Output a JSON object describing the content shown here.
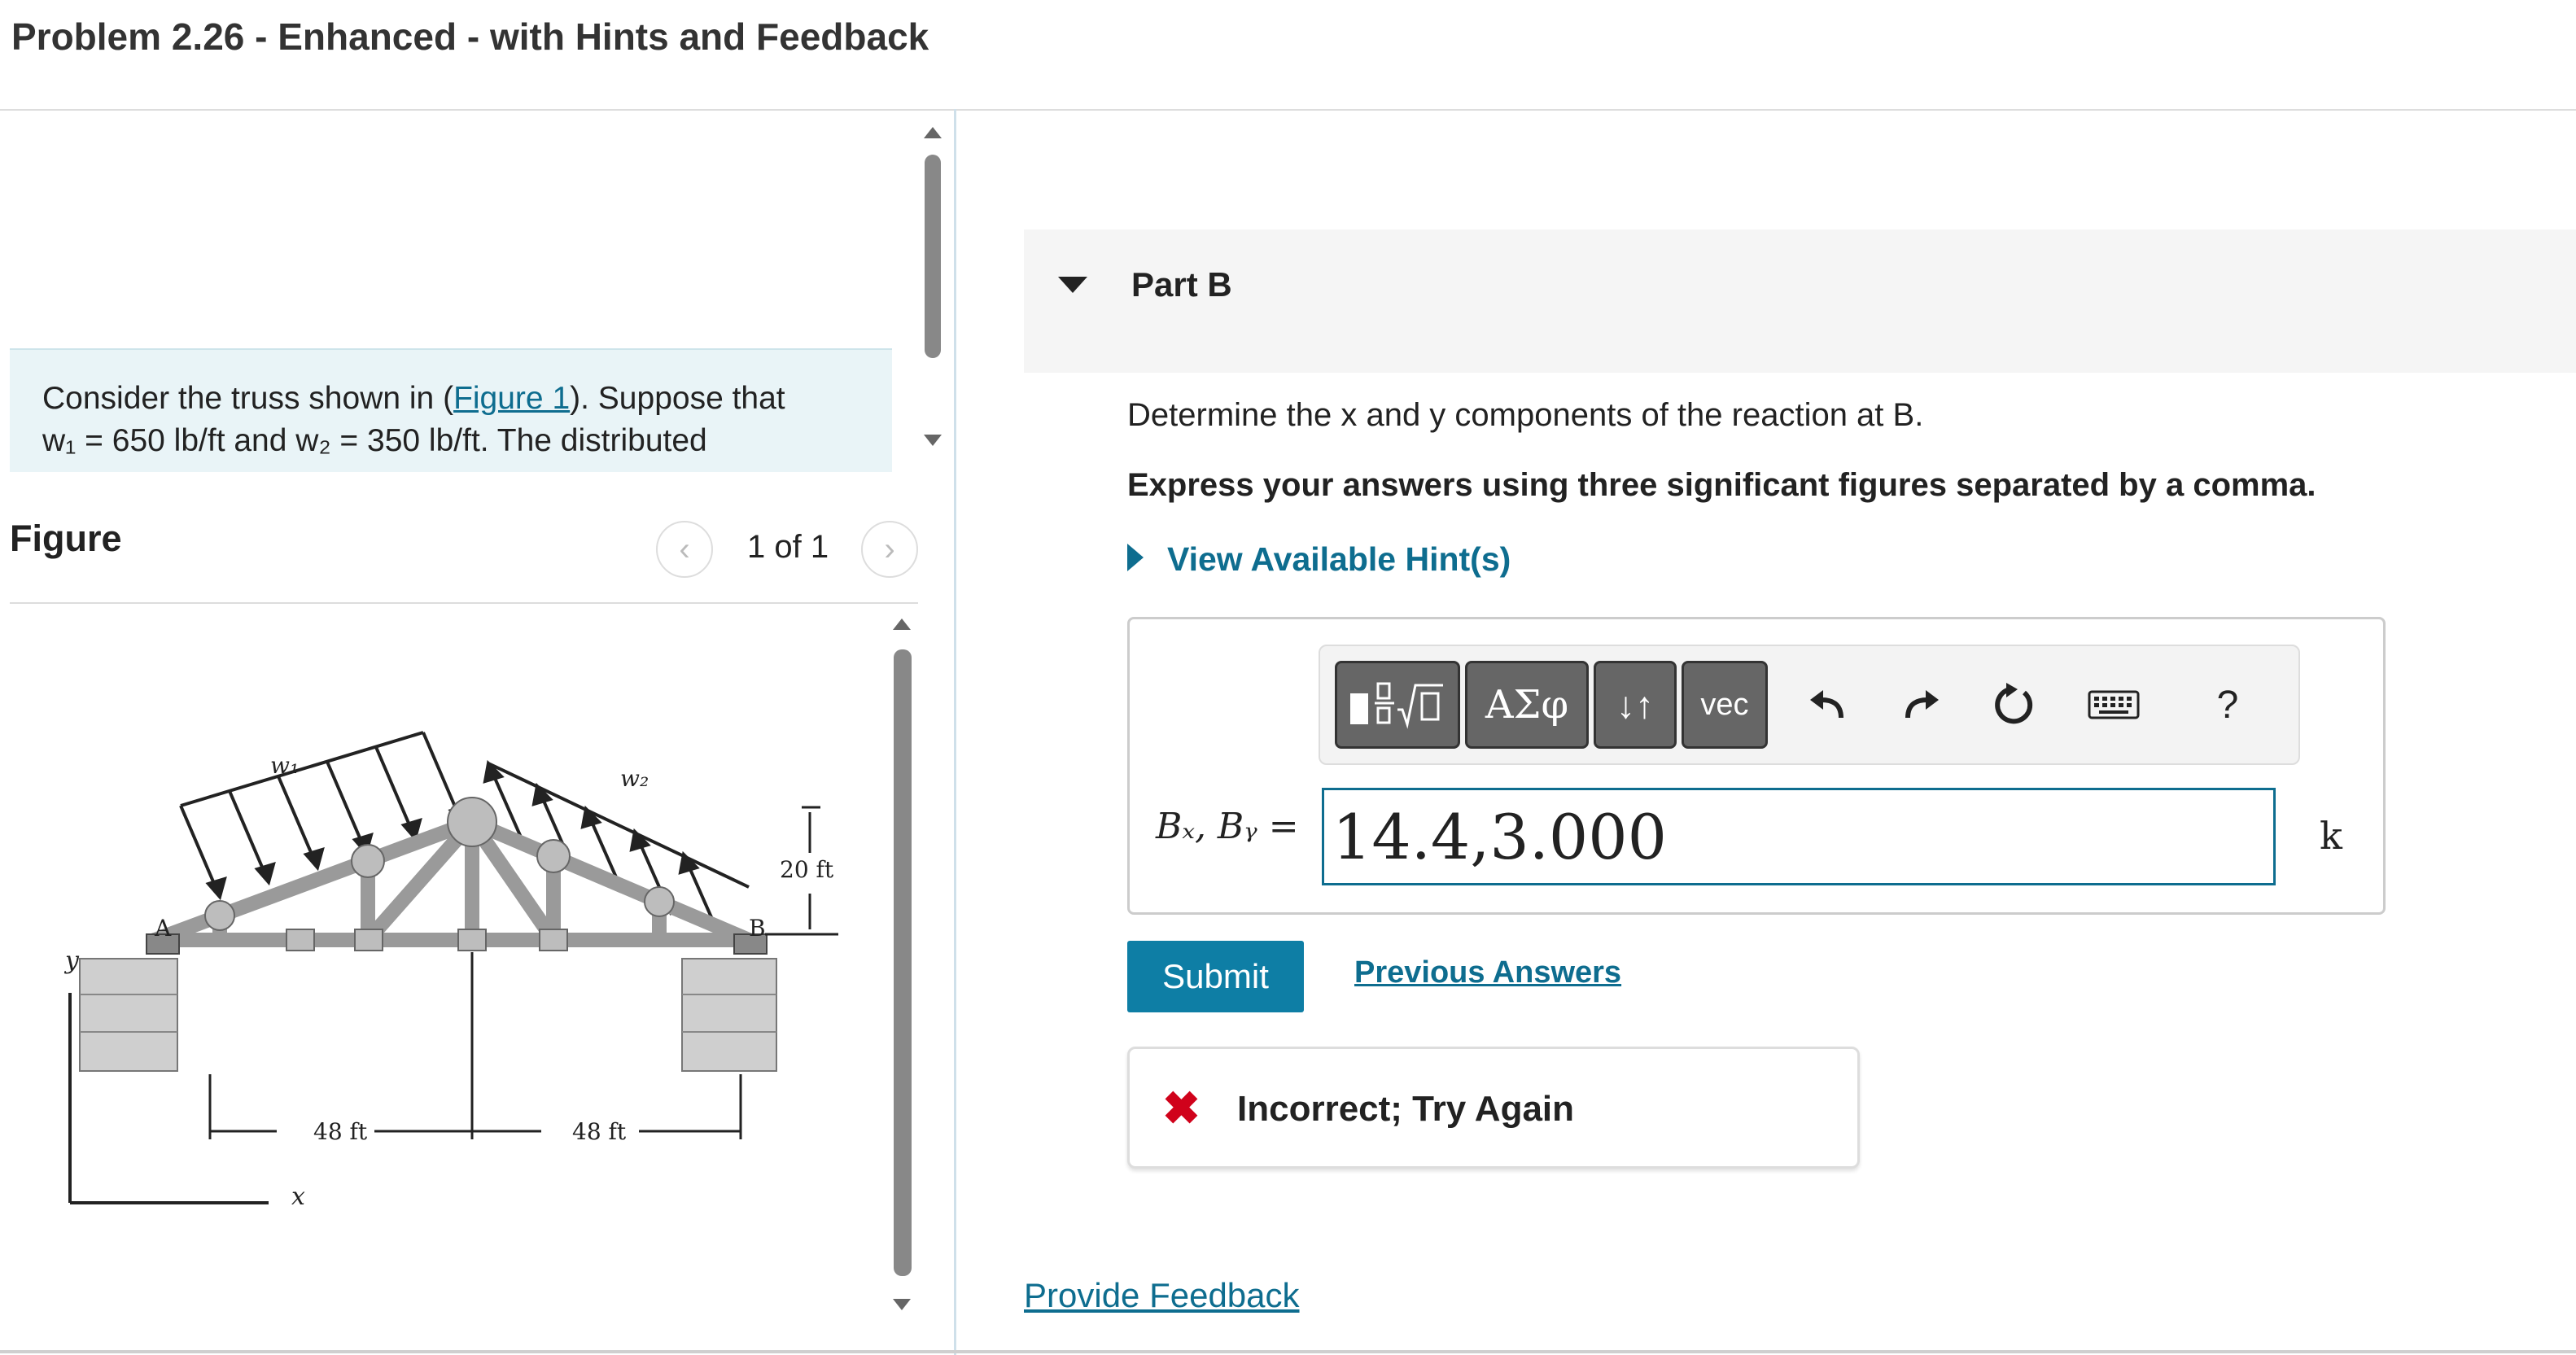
{
  "header": {
    "title": "Problem 2.26 - Enhanced - with Hints and Feedback"
  },
  "problem": {
    "line1_before": "Consider the truss shown in (",
    "figure_link": "Figure 1",
    "line1_after": "). Suppose that",
    "line2": "w₁ = 650 lb/ft and w₂ = 350 lb/ft. The distributed"
  },
  "figure_panel": {
    "label": "Figure",
    "count": "1 of 1",
    "prev_icon": "chevron-left-icon",
    "next_icon": "chevron-right-icon",
    "labels": {
      "w1": "w₁",
      "w2": "w₂",
      "height": "20 ft",
      "span1": "48 ft",
      "span2": "48 ft",
      "A": "A",
      "B": "B",
      "x": "x",
      "y": "y"
    }
  },
  "part": {
    "title": "Part B",
    "question": "Determine the x and y components of the reaction at B.",
    "instruction": "Express your answers using three significant figures separated by a comma.",
    "hint_link": "View Available Hint(s)"
  },
  "toolbar": {
    "template_icon": "fraction-radical-template-icon",
    "greek_label": "ΑΣφ",
    "arrows_label": "↓↑",
    "vec_label": "vec",
    "undo_icon": "undo-icon",
    "redo_icon": "redo-icon",
    "reset_icon": "reset-icon",
    "keyboard_icon": "keyboard-icon",
    "help_label": "?"
  },
  "answer": {
    "label": "Bₓ, Bᵧ =",
    "value": "14.4,3.000",
    "unit": "k"
  },
  "actions": {
    "submit_label": "Submit",
    "previous_answers": "Previous Answers"
  },
  "feedback": {
    "icon": "x-mark-icon",
    "text": "Incorrect; Try Again"
  },
  "footer": {
    "provide_feedback": "Provide Feedback"
  },
  "colors": {
    "accent": "#0e7ea5",
    "link": "#0e6d8f",
    "error": "#d0021b",
    "problem_bg": "#e9f4f7"
  }
}
